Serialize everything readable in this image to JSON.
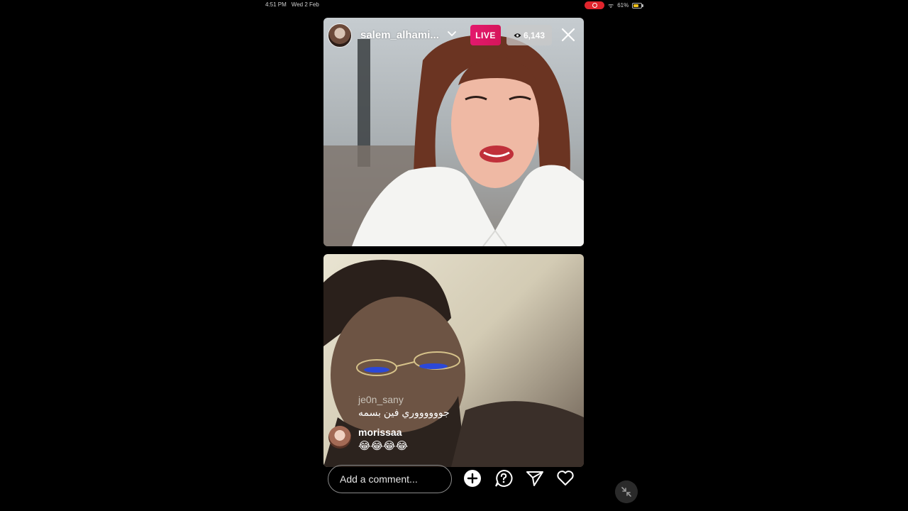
{
  "status_bar": {
    "time": "4:51 PM",
    "date": "Wed 2 Feb",
    "battery": "61%"
  },
  "live": {
    "host_username": "salem_alhami...",
    "live_label": "LIVE",
    "viewer_count": "6,143"
  },
  "comments": [
    {
      "username": "je0n_sany",
      "text": "جووووووري فين بسمه"
    },
    {
      "username": "morissaa",
      "text": "😂😂😂😂"
    }
  ],
  "comment_input": {
    "placeholder": "Add a comment..."
  },
  "icons": [
    "chevron-down-icon",
    "eye-icon",
    "close-icon",
    "plus-circle-icon",
    "question-bubble-icon",
    "send-icon",
    "heart-icon",
    "minimize-icon"
  ]
}
